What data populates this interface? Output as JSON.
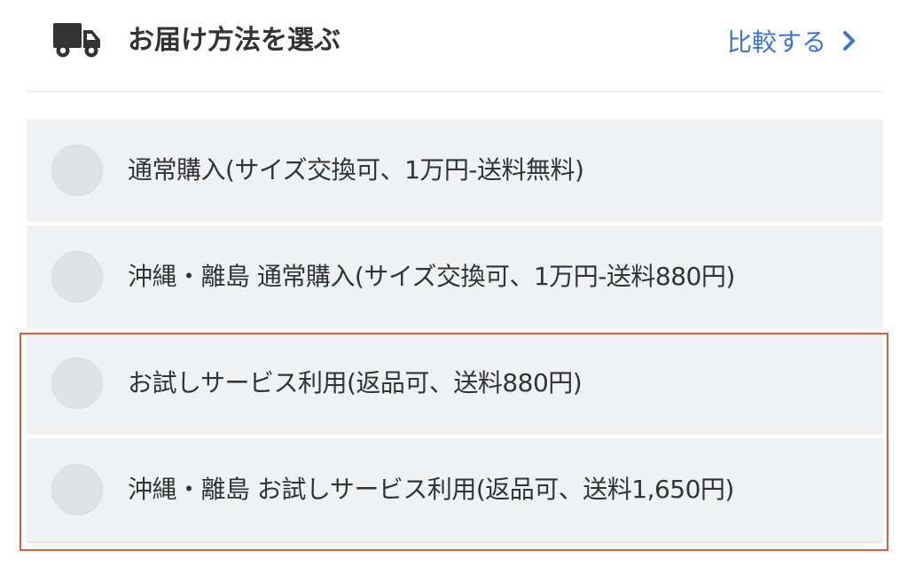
{
  "header": {
    "title": "お届け方法を選ぶ",
    "compare_label": "比較する"
  },
  "options": [
    {
      "label": "通常購入(サイズ交換可、1万円-送料無料)",
      "selected": false
    },
    {
      "label": "沖縄・離島 通常購入(サイズ交換可、1万円-送料880円)",
      "selected": false
    },
    {
      "label": "お試しサービス利用(返品可、送料880円)",
      "selected": false
    },
    {
      "label": "沖縄・離島 お試しサービス利用(返品可、送料1,650円)",
      "selected": false
    }
  ],
  "colors": {
    "link": "#3f74d6",
    "option_bg": "#f0f1f3",
    "radio": "#dfe3e6",
    "highlight": "#e05a3a",
    "icon": "#333333"
  },
  "icons": {
    "header": "truck-icon",
    "compare": "chevron-right-icon"
  }
}
